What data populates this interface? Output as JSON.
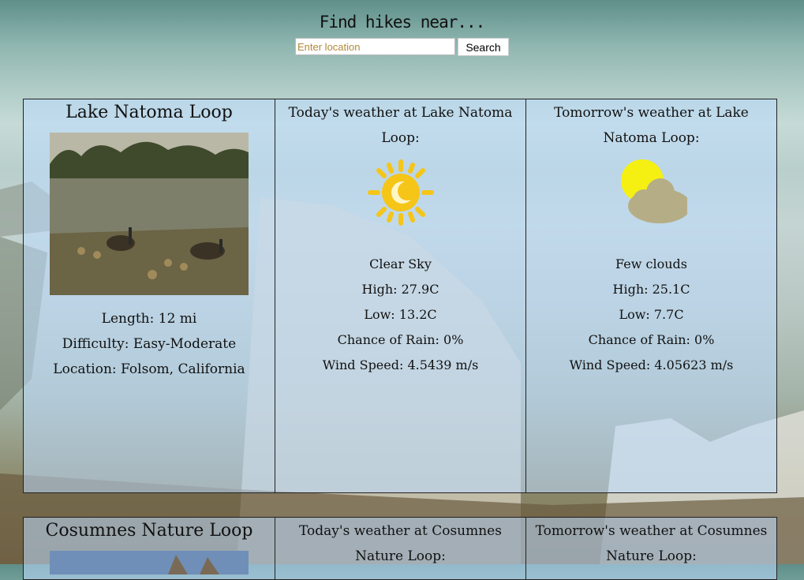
{
  "header": {
    "title": "Find hikes near...",
    "search_placeholder": "Enter location",
    "search_button": "Search"
  },
  "trails": [
    {
      "name": "Lake Natoma Loop",
      "length": "Length: 12 mi",
      "difficulty": "Difficulty: Easy-Moderate",
      "location": "Location: Folsom, California",
      "today": {
        "title": "Today's weather at Lake Natoma Loop:",
        "icon": "sun-icon",
        "description": "Clear Sky",
        "high": "High: 27.9C",
        "low": "Low: 13.2C",
        "rain": "Chance of Rain: 0%",
        "wind": "Wind Speed: 4.5439 m/s"
      },
      "tomorrow": {
        "title": "Tomorrow's weather at Lake Natoma Loop:",
        "icon": "sun-cloud-icon",
        "description": "Few clouds",
        "high": "High: 25.1C",
        "low": "Low: 7.7C",
        "rain": "Chance of Rain: 0%",
        "wind": "Wind Speed: 4.05623 m/s"
      }
    },
    {
      "name": "Cosumnes Nature Loop",
      "today": {
        "title": "Today's weather at Cosumnes Nature Loop:"
      },
      "tomorrow": {
        "title": "Tomorrow's weather at Cosumnes Nature Loop:"
      }
    }
  ],
  "colors": {
    "cell_bg": "#bedcff",
    "sun": "#f5c518",
    "cloud": "#b5ad86"
  }
}
